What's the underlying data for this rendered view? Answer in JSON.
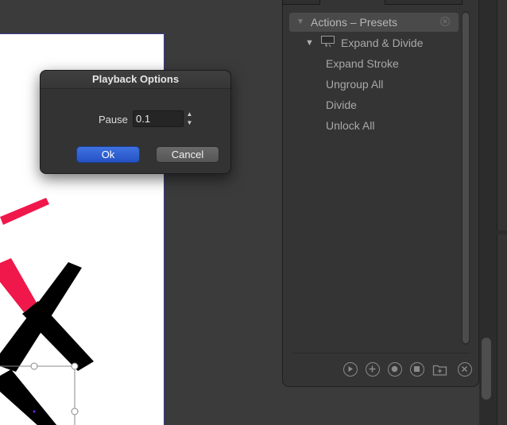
{
  "dialog": {
    "title": "Playback Options",
    "pause_label": "Pause",
    "pause_value": "0.1",
    "ok_label": "Ok",
    "cancel_label": "Cancel",
    "stepper_up_icon": "stepper-up-arrow",
    "stepper_down_icon": "stepper-down-arrow"
  },
  "actions_panel": {
    "set_name": "Actions – Presets",
    "action_name": "Expand & Divide",
    "steps": [
      "Expand Stroke",
      "Ungroup All",
      "Divide",
      "Unlock All"
    ],
    "toolbar_icons": [
      "play-icon",
      "new-action-icon",
      "record-icon",
      "stop-icon",
      "new-set-icon",
      "delete-icon"
    ]
  },
  "colors": {
    "ok_accent": "#2f5fd6",
    "stroke_pink": "#f0174b",
    "stroke_black": "#000000",
    "panel_bg": "#343434",
    "artboard_border": "#3a3a9a"
  }
}
